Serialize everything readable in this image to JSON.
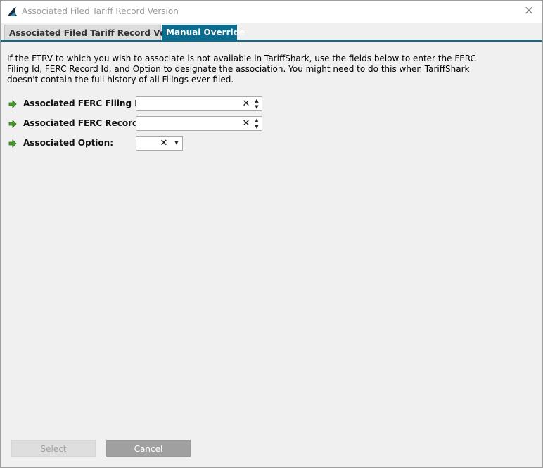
{
  "window": {
    "title": "Associated Filed Tariff Record Version",
    "close_glyph": "×"
  },
  "tabs": [
    {
      "label": "Associated Filed Tariff Record Version",
      "active": false
    },
    {
      "label": "Manual Override",
      "active": true
    }
  ],
  "description": "If the FTRV to which you wish to associate is not available in TariffShark, use the fields below to enter the FERC Filing Id, FERC Record Id, and Option to designate the association. You might need to do this when TariffShark doesn't contain the full history of all Filings ever filed.",
  "fields": [
    {
      "label": "Associated FERC Filing Id:",
      "value": "",
      "clear_glyph": "✕",
      "spin_up": "▲",
      "spin_down": "▼"
    },
    {
      "label": "Associated FERC Record Id:",
      "value": "",
      "clear_glyph": "✕",
      "spin_up": "▲",
      "spin_down": "▼"
    },
    {
      "label": "Associated Option:",
      "value": "",
      "clear_glyph": "✕",
      "dropdown_glyph": "▼"
    }
  ],
  "buttons": {
    "select_label": "Select",
    "cancel_label": "Cancel"
  },
  "icons": {
    "app": "shark-fin-icon",
    "field_marker": "green-arrow-icon"
  },
  "colors": {
    "accent": "#0b6c8d",
    "arrow": "#4a9a2a",
    "disabled_button": "#dedede",
    "cancel_button": "#a0a0a0"
  }
}
